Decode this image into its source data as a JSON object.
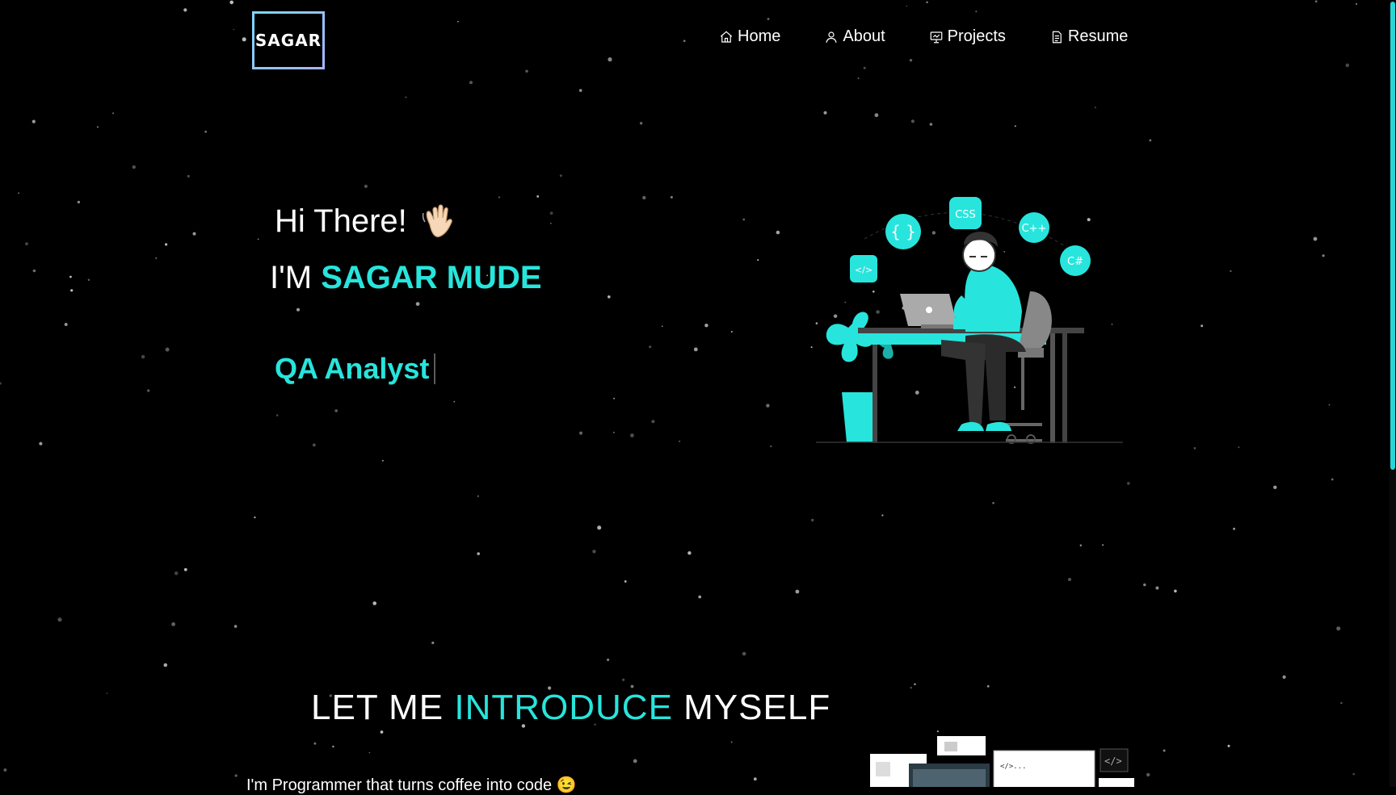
{
  "brand": {
    "logo_text": "SAGAR"
  },
  "nav": {
    "items": [
      {
        "label": "Home",
        "icon": "home-icon"
      },
      {
        "label": "About",
        "icon": "user-icon"
      },
      {
        "label": "Projects",
        "icon": "presentation-icon"
      },
      {
        "label": "Resume",
        "icon": "document-icon"
      }
    ]
  },
  "hero": {
    "greeting": "Hi There!",
    "greeting_emoji": "waving-hand-icon",
    "intro_prefix": "I'M",
    "name": "SAGAR MUDE",
    "role": "QA Analyst",
    "illustration_badges": [
      "{ }",
      "CSS",
      "C++",
      "</>",
      "C#"
    ]
  },
  "about": {
    "title_part1": "LET ME",
    "title_accent": "INTRODUCE",
    "title_part2": "MYSELF",
    "intro_text": "I'm Programmer that turns coffee into code 😉"
  },
  "colors": {
    "accent": "#27e5dc",
    "background": "#000000",
    "scrollbar": "#27d7d7"
  }
}
